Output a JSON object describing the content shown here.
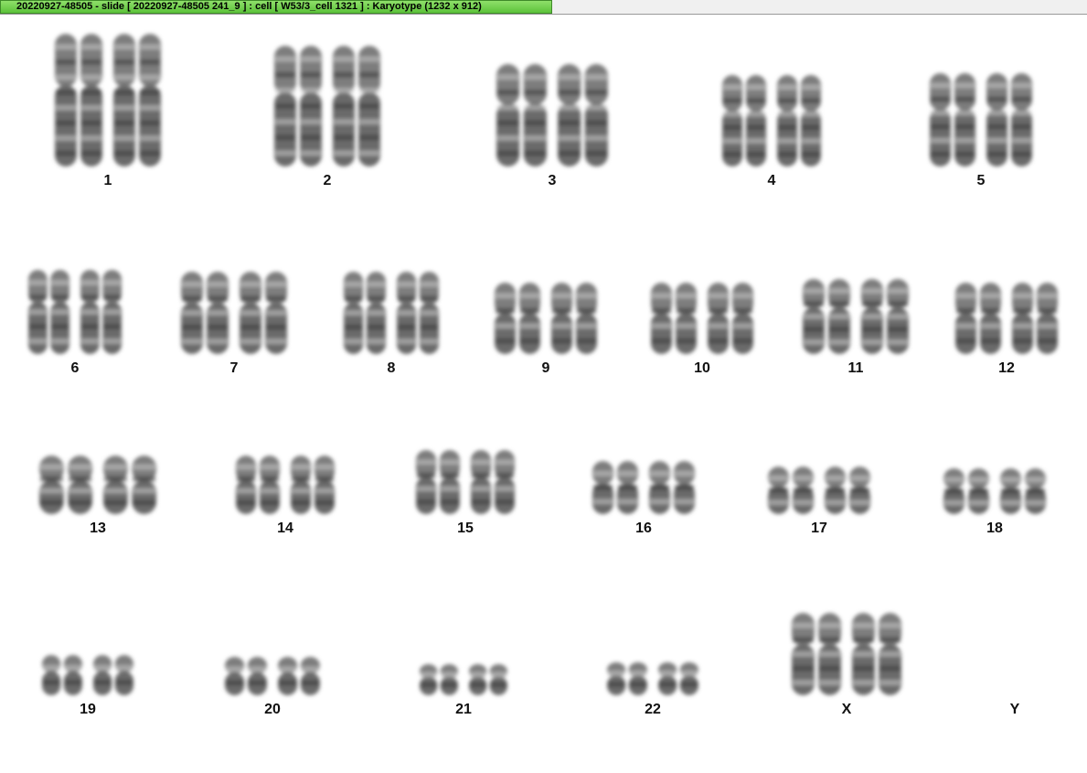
{
  "window": {
    "title": "20220927-48505 - slide [ 20220927-48505 241_9 ] : cell [ W53/3_cell 1321 ] : Karyotype  (1232 x 912)"
  },
  "karyotype": {
    "chromosomes": [
      {
        "label": "1",
        "count": 2
      },
      {
        "label": "2",
        "count": 2
      },
      {
        "label": "3",
        "count": 2
      },
      {
        "label": "4",
        "count": 2
      },
      {
        "label": "5",
        "count": 2
      },
      {
        "label": "6",
        "count": 2
      },
      {
        "label": "7",
        "count": 2
      },
      {
        "label": "8",
        "count": 2
      },
      {
        "label": "9",
        "count": 2
      },
      {
        "label": "10",
        "count": 2
      },
      {
        "label": "11",
        "count": 2
      },
      {
        "label": "12",
        "count": 2
      },
      {
        "label": "13",
        "count": 2
      },
      {
        "label": "14",
        "count": 2
      },
      {
        "label": "15",
        "count": 2
      },
      {
        "label": "16",
        "count": 2
      },
      {
        "label": "17",
        "count": 2
      },
      {
        "label": "18",
        "count": 2
      },
      {
        "label": "19",
        "count": 2
      },
      {
        "label": "20",
        "count": 2
      },
      {
        "label": "21",
        "count": 2
      },
      {
        "label": "22",
        "count": 2
      },
      {
        "label": "X",
        "count": 2
      },
      {
        "label": "Y",
        "count": 0
      }
    ]
  }
}
